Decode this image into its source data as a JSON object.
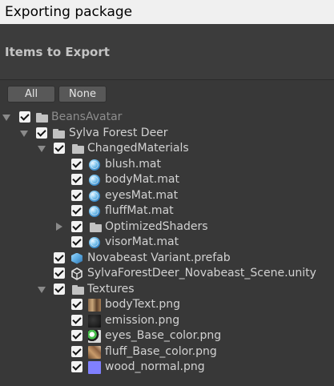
{
  "window": {
    "title": "Exporting package"
  },
  "header": {
    "title": "Items to Export"
  },
  "buttons": {
    "all": "All",
    "none": "None"
  },
  "tree": [
    {
      "label": "BeansAvatar",
      "icon": "folder-icon",
      "expanded": true,
      "checked": true
    },
    {
      "label": "Sylva Forest Deer",
      "icon": "folder-icon",
      "expanded": true,
      "checked": true
    },
    {
      "label": "ChangedMaterials",
      "icon": "folder-icon",
      "expanded": true,
      "checked": true
    },
    {
      "label": "blush.mat",
      "icon": "material-icon",
      "checked": true
    },
    {
      "label": "bodyMat.mat",
      "icon": "material-icon",
      "checked": true
    },
    {
      "label": "eyesMat.mat",
      "icon": "material-icon",
      "checked": true
    },
    {
      "label": "fluffMat.mat",
      "icon": "material-icon",
      "checked": true
    },
    {
      "label": "OptimizedShaders",
      "icon": "folder-icon",
      "expanded": false,
      "checked": true
    },
    {
      "label": "visorMat.mat",
      "icon": "material-icon",
      "checked": true
    },
    {
      "label": "Novabeast Variant.prefab",
      "icon": "prefab-variant-icon",
      "checked": true
    },
    {
      "label": "SylvaForestDeer_Novabeast_Scene.unity",
      "icon": "unity-scene-icon",
      "checked": true
    },
    {
      "label": "Textures",
      "icon": "folder-icon",
      "expanded": true,
      "checked": true
    },
    {
      "label": "bodyText.png",
      "icon": "texture-icon",
      "checked": true
    },
    {
      "label": "emission.png",
      "icon": "texture-icon",
      "checked": true
    },
    {
      "label": "eyes_Base_color.png",
      "icon": "texture-icon",
      "checked": true
    },
    {
      "label": "fluff_Base_color.png",
      "icon": "texture-icon",
      "checked": true
    },
    {
      "label": "wood_normal.png",
      "icon": "texture-icon",
      "checked": true
    }
  ]
}
